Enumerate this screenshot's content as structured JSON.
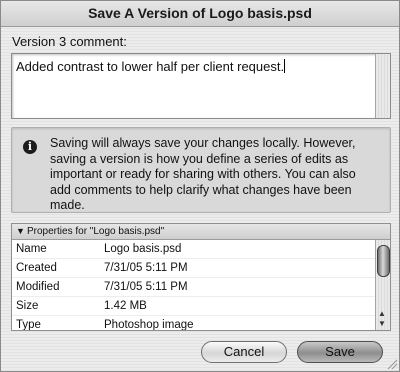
{
  "window": {
    "title": "Save A Version of Logo basis.psd"
  },
  "comment": {
    "label": "Version 3 comment:",
    "value": "Added contrast to lower half per client request."
  },
  "info": {
    "icon": "info-icon",
    "text": "Saving will always save your changes locally.  However, saving a version is how you define a series of edits as important or ready for sharing with others.  You can also add comments to help clarify what changes have been made."
  },
  "properties": {
    "header": "Properties for \"Logo basis.psd\"",
    "rows": [
      {
        "key": "Name",
        "value": "Logo basis.psd"
      },
      {
        "key": "Created",
        "value": "7/31/05 5:11 PM"
      },
      {
        "key": "Modified",
        "value": "7/31/05 5:11 PM"
      },
      {
        "key": "Size",
        "value": "1.42 MB"
      },
      {
        "key": "Type",
        "value": "Photoshop image"
      }
    ]
  },
  "buttons": {
    "cancel": "Cancel",
    "save": "Save"
  }
}
